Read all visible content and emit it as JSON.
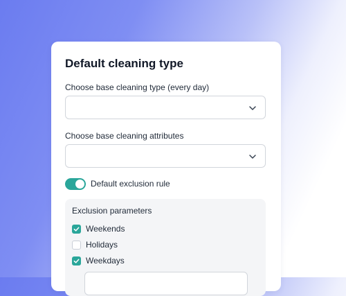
{
  "card": {
    "title": "Default cleaning type",
    "base_type_label": "Choose base cleaning type (every day)",
    "base_type_value": "",
    "attributes_label": "Choose base cleaning attributes",
    "attributes_value": "",
    "exclusion_toggle": {
      "label": "Default exclusion rule",
      "on": true
    },
    "exclusion_panel": {
      "title": "Exclusion parameters",
      "options": [
        {
          "label": "Weekends",
          "checked": true
        },
        {
          "label": "Holidays",
          "checked": false
        },
        {
          "label": "Weekdays",
          "checked": true
        }
      ],
      "weekdays_field_value": ""
    }
  },
  "colors": {
    "accent": "#2aa69a",
    "background_gradient_start": "#6b7cf0"
  },
  "icons": {
    "select_arrow": "chevron-down-icon",
    "check": "check-icon"
  }
}
